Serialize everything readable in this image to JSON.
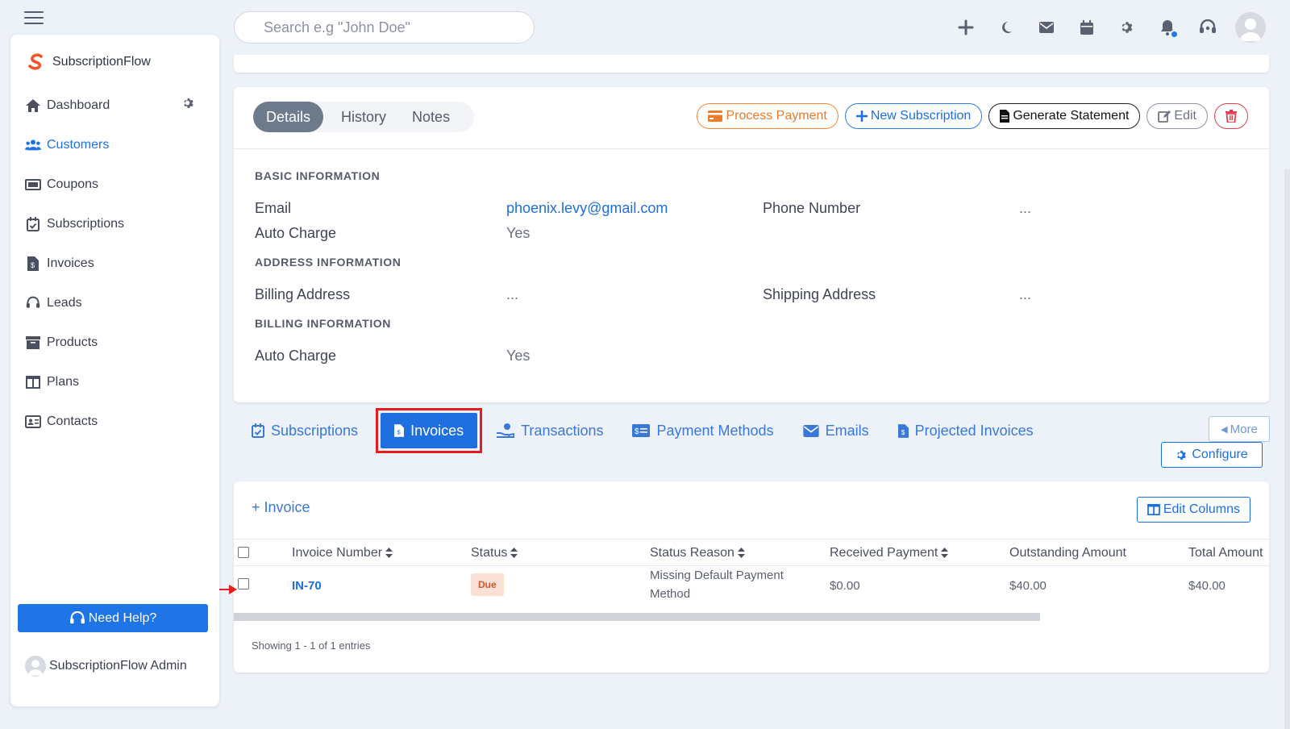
{
  "topbar": {
    "search_placeholder": "Search e.g \"John Doe\"",
    "icons": [
      "plus-icon",
      "moon-icon",
      "mail-icon",
      "calendar-icon",
      "gear-icon",
      "bell-icon",
      "headset-icon",
      "avatar"
    ]
  },
  "sidebar": {
    "brand": "SubscriptionFlow",
    "items": [
      {
        "label": "Dashboard",
        "icon": "home-icon"
      },
      {
        "label": "Customers",
        "icon": "users-icon",
        "active": true
      },
      {
        "label": "Coupons",
        "icon": "ticket-icon"
      },
      {
        "label": "Subscriptions",
        "icon": "calendar-check-icon"
      },
      {
        "label": "Invoices",
        "icon": "invoice-icon"
      },
      {
        "label": "Leads",
        "icon": "headset-icon"
      },
      {
        "label": "Products",
        "icon": "archive-icon"
      },
      {
        "label": "Plans",
        "icon": "columns-icon"
      },
      {
        "label": "Contacts",
        "icon": "id-card-icon"
      }
    ],
    "help_label": "Need Help?",
    "admin_name": "SubscriptionFlow Admin"
  },
  "details": {
    "tabs": [
      "Details",
      "History",
      "Notes"
    ],
    "actions": {
      "process_payment": "Process Payment",
      "new_subscription": "New Subscription",
      "generate_statement": "Generate Statement",
      "edit": "Edit"
    },
    "basic_title": "BASIC INFORMATION",
    "email_label": "Email",
    "email_value": "phoenix.levy@gmail.com",
    "phone_label": "Phone Number",
    "phone_value": "...",
    "auto_charge_label": "Auto Charge",
    "auto_charge_value": "Yes",
    "address_title": "ADDRESS INFORMATION",
    "billing_address_label": "Billing Address",
    "billing_address_value": "...",
    "shipping_address_label": "Shipping Address",
    "shipping_address_value": "...",
    "billing_title": "BILLING INFORMATION",
    "billing_auto_charge_label": "Auto Charge",
    "billing_auto_charge_value": "Yes"
  },
  "subtabs": {
    "items": [
      "Subscriptions",
      "Invoices",
      "Transactions",
      "Payment Methods",
      "Emails",
      "Projected Invoices"
    ],
    "active": "Invoices",
    "more": "More",
    "configure": "Configure"
  },
  "invoices": {
    "add_label": "+ Invoice",
    "edit_columns": "Edit Columns",
    "columns": [
      "Invoice Number",
      "Status",
      "Status Reason",
      "Received Payment",
      "Outstanding Amount",
      "Total Amount"
    ],
    "rows": [
      {
        "invoice_number": "IN-70",
        "status": "Due",
        "status_reason_line1": "Missing Default Payment",
        "status_reason_line2": "Method",
        "received_payment": "$0.00",
        "outstanding_amount": "$40.00",
        "total_amount": "$40.00"
      }
    ],
    "showing": "Showing 1 - 1 of 1 entries"
  },
  "colors": {
    "primary": "#1f74e6",
    "highlight": "#e81c1c",
    "orange": "#ef7a27",
    "background": "#edf1f8"
  }
}
